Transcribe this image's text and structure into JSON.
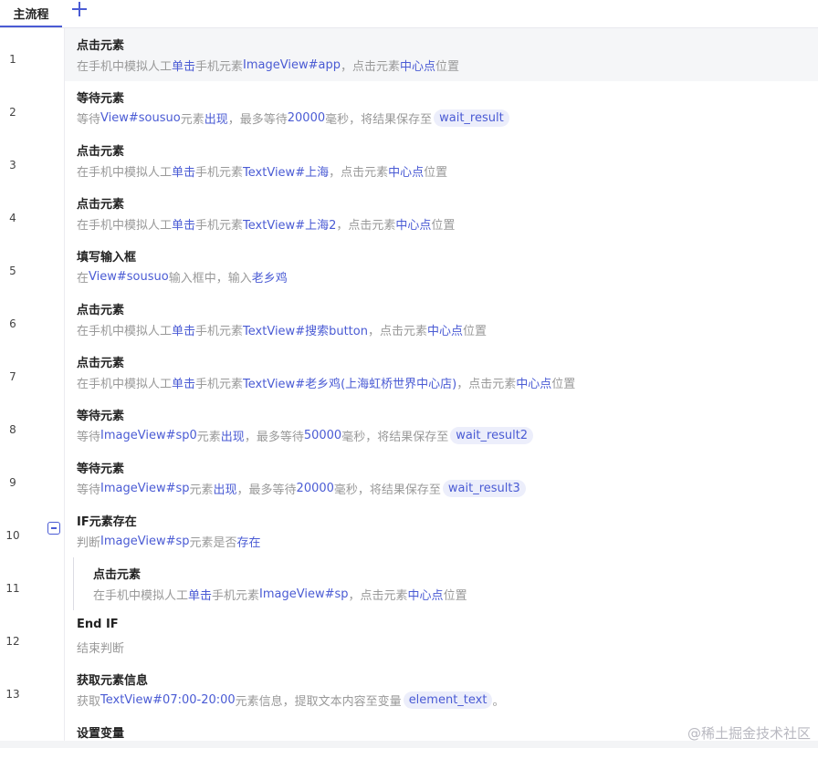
{
  "tabs": {
    "main_label": "主流程",
    "add_icon": "plus-icon"
  },
  "rows": [
    {
      "num": "1",
      "title": "点击元素",
      "desc": [
        "在手机中模拟人工",
        {
          "hl": "单击"
        },
        "手机元素",
        {
          "hl": "ImageView#app"
        },
        "，点击元素",
        {
          "hl": "中心点"
        },
        "位置"
      ]
    },
    {
      "num": "2",
      "title": "等待元素",
      "desc": [
        "等待",
        {
          "hl": "View#sousuo"
        },
        "元素",
        {
          "hl": "出现"
        },
        "，最多等待",
        {
          "hl": "20000"
        },
        "毫秒，将结果保存至",
        {
          "pill": "wait_result"
        }
      ]
    },
    {
      "num": "3",
      "title": "点击元素",
      "desc": [
        "在手机中模拟人工",
        {
          "hl": "单击"
        },
        "手机元素",
        {
          "hl": "TextView#上海"
        },
        "，点击元素",
        {
          "hl": "中心点"
        },
        "位置"
      ]
    },
    {
      "num": "4",
      "title": "点击元素",
      "desc": [
        "在手机中模拟人工",
        {
          "hl": "单击"
        },
        "手机元素",
        {
          "hl": "TextView#上海2"
        },
        "，点击元素",
        {
          "hl": "中心点"
        },
        "位置"
      ]
    },
    {
      "num": "5",
      "title": "填写输入框",
      "desc": [
        "在",
        {
          "hl": "View#sousuo"
        },
        "输入框中，输入",
        {
          "hl": "老乡鸡"
        }
      ]
    },
    {
      "num": "6",
      "title": "点击元素",
      "desc": [
        "在手机中模拟人工",
        {
          "hl": "单击"
        },
        "手机元素",
        {
          "hl": "TextView#搜索button"
        },
        "，点击元素",
        {
          "hl": "中心点"
        },
        "位置"
      ]
    },
    {
      "num": "7",
      "title": "点击元素",
      "desc": [
        "在手机中模拟人工",
        {
          "hl": "单击"
        },
        "手机元素",
        {
          "hl": "TextView#老乡鸡(上海虹桥世界中心店)"
        },
        "，点击元素",
        {
          "hl": "中心点"
        },
        "位置"
      ]
    },
    {
      "num": "8",
      "title": "等待元素",
      "desc": [
        "等待",
        {
          "hl": "ImageView#sp0"
        },
        "元素",
        {
          "hl": "出现"
        },
        "，最多等待",
        {
          "hl": "50000"
        },
        "毫秒，将结果保存至",
        {
          "pill": "wait_result2"
        }
      ]
    },
    {
      "num": "9",
      "title": "等待元素",
      "desc": [
        "等待",
        {
          "hl": "ImageView#sp"
        },
        "元素",
        {
          "hl": "出现"
        },
        "，最多等待",
        {
          "hl": "20000"
        },
        "毫秒，将结果保存至",
        {
          "pill": "wait_result3"
        }
      ]
    },
    {
      "num": "10",
      "title": "IF元素存在",
      "collapsible": true,
      "desc": [
        "判断",
        {
          "hl": "ImageView#sp"
        },
        "元素是否",
        {
          "hl": "存在"
        }
      ]
    },
    {
      "num": "11",
      "title": "点击元素",
      "indent": true,
      "desc": [
        "在手机中模拟人工",
        {
          "hl": "单击"
        },
        "手机元素",
        {
          "hl": "ImageView#sp"
        },
        "，点击元素",
        {
          "hl": "中心点"
        },
        "位置"
      ]
    },
    {
      "num": "12",
      "title": "End IF",
      "desc": [
        "结束判断"
      ]
    },
    {
      "num": "13",
      "title": "获取元素信息",
      "desc": [
        "获取",
        {
          "hl": "TextView#07:00-20:00"
        },
        "元素信息，提取文本内容至变量",
        {
          "pill": "element_text"
        },
        "。"
      ]
    },
    {
      "num": "",
      "title": "设置变量",
      "desc": []
    }
  ],
  "watermark": "@稀土掘金技术社区",
  "colors": {
    "accent": "#4a5bd4",
    "pill_bg": "#eceefb",
    "muted": "#999999"
  }
}
